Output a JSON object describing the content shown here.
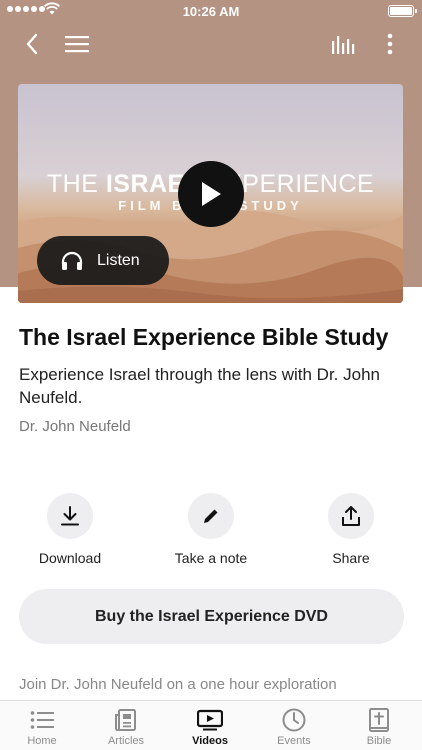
{
  "status_bar": {
    "time": "10:26 AM"
  },
  "nav": {
    "icons": [
      "back-icon",
      "menu-icon",
      "bar-chart-icon",
      "more-vertical-icon"
    ]
  },
  "hero": {
    "title_pre": "THE ",
    "title_bold": "ISRAEL",
    "title_post": " EXPERIENCE",
    "subtitle": "FILM BIBLE STUDY",
    "listen_label": "Listen"
  },
  "content": {
    "title": "The Israel Experience Bible Study",
    "description": "Experience Israel through the lens with Dr. John Neufeld.",
    "author": "Dr. John Neufeld"
  },
  "actions": [
    {
      "label": "Download",
      "icon": "download-icon"
    },
    {
      "label": "Take a note",
      "icon": "pencil-icon"
    },
    {
      "label": "Share",
      "icon": "share-icon"
    }
  ],
  "buy_label": "Buy the Israel Experience DVD",
  "teaser": "Join Dr. John Neufeld on a one hour exploration",
  "tabs": [
    {
      "label": "Home",
      "icon": "list-icon",
      "active": false
    },
    {
      "label": "Articles",
      "icon": "newspaper-icon",
      "active": false
    },
    {
      "label": "Videos",
      "icon": "video-icon",
      "active": true
    },
    {
      "label": "Events",
      "icon": "clock-icon",
      "active": false
    },
    {
      "label": "Bible",
      "icon": "bible-icon",
      "active": false
    }
  ],
  "colors": {
    "header_bg": "#b59383",
    "button_bg": "#eeeef0",
    "active_tab": "#111111",
    "inactive_tab": "#8d8d8d"
  }
}
